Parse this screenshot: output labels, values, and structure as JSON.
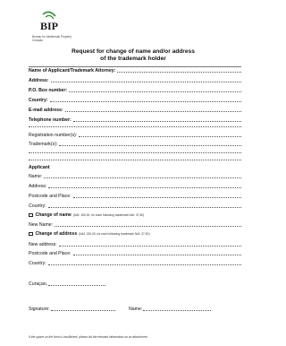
{
  "logo": {
    "mark": "BIP",
    "line1": "Bureau for Intellectual Property",
    "line2": "Curaçao",
    "green": "#2e8b2e",
    "dark": "#1a1a1a"
  },
  "title": {
    "line1": "Request for change of name and/or address",
    "line2": "of the trademark holder"
  },
  "holder": {
    "name_label": "Name of Applicant/Trademark Attorney:",
    "address_label": "Address:",
    "pobox_label": "P.O. Box number:",
    "country_label": "Country:",
    "email_label": "E-mail address:",
    "telephone_label": "Telephone number:"
  },
  "registration": {
    "regnum_label": "Registration number(s):",
    "trademarks_label": "Trademark(s):"
  },
  "applicant": {
    "heading": "Applicant",
    "name_label": "Name:",
    "address_label": "Address:",
    "postcode_label": "Postcode and Place:",
    "country_label": "Country:"
  },
  "change_name": {
    "label": "Change of name",
    "note": "(NAf. 150,00, for each following trademark NAf. 37,50)",
    "new_name_label": "New Name:"
  },
  "change_address": {
    "label": "Change of address",
    "note": "(NAf. 150,00, for each following trademark NAf. 37,50)",
    "new_address_label": "New address:",
    "postcode_label": "Postcode and Place:",
    "country_label": "Country:"
  },
  "sign": {
    "place_label": "Curaçao,",
    "signature_label": "Signature:",
    "name_label": "Name:"
  },
  "footnote": "If the space on the form is insufficient, please list the relevant information on an attachment"
}
